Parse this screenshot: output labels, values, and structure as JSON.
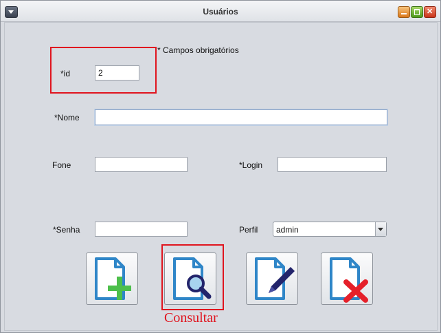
{
  "window": {
    "title": "Usuários"
  },
  "form": {
    "required_note": "* Campos obrigatórios",
    "id": {
      "label": "*id",
      "value": "2"
    },
    "nome": {
      "label": "*Nome",
      "value": ""
    },
    "fone": {
      "label": "Fone",
      "value": ""
    },
    "login": {
      "label": "*Login",
      "value": ""
    },
    "senha": {
      "label": "*Senha",
      "value": ""
    },
    "perfil": {
      "label": "Perfil",
      "selected": "admin"
    }
  },
  "actions": [
    {
      "name": "add",
      "icon": "document-add-icon"
    },
    {
      "name": "consultar",
      "icon": "document-search-icon"
    },
    {
      "name": "edit",
      "icon": "document-edit-icon"
    },
    {
      "name": "delete",
      "icon": "document-delete-icon"
    }
  ],
  "annotation": {
    "text": "Consultar",
    "color": "#e0141e"
  },
  "colors": {
    "icon_blue": "#2f86c8",
    "add_green": "#4cbf4a",
    "delete_red": "#e5202a",
    "search_dark": "#23246b"
  }
}
